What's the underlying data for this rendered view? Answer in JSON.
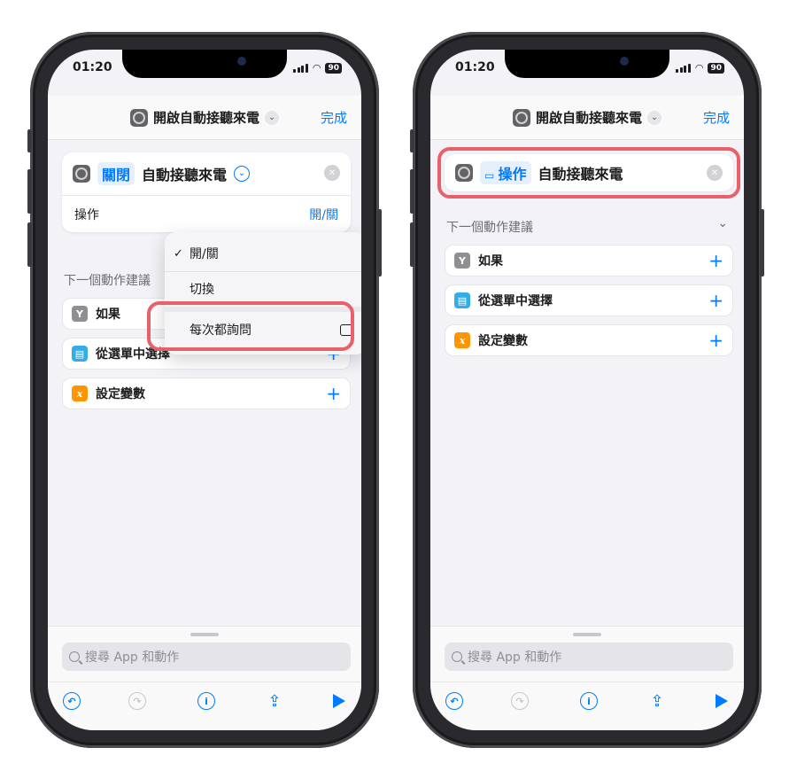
{
  "status": {
    "time": "01:20",
    "battery": "90"
  },
  "header": {
    "title": "開啟自動接聽來電",
    "done_label": "完成"
  },
  "left": {
    "action": {
      "token": "關閉",
      "text": "自動接聽來電",
      "param_label": "操作",
      "param_value": "開/關"
    },
    "section_title": "下一個動作建議",
    "suggestions": [
      {
        "label": "如果",
        "icon": "fork-icon",
        "color": "#8e8e93"
      },
      {
        "label": "從選單中選擇",
        "icon": "menu-icon",
        "color": "#32ade6"
      },
      {
        "label": "設定變數",
        "icon": "variable-icon",
        "color": "#ff9500"
      }
    ],
    "menu": {
      "items": [
        "開/關",
        "切換",
        "每次都詢問"
      ],
      "checked_index": 0
    }
  },
  "right": {
    "action": {
      "token": "操作",
      "text": "自動接聽來電"
    },
    "section_title": "下一個動作建議",
    "suggestions": [
      {
        "label": "如果",
        "icon": "fork-icon",
        "color": "#8e8e93"
      },
      {
        "label": "從選單中選擇",
        "icon": "menu-icon",
        "color": "#32ade6"
      },
      {
        "label": "設定變數",
        "icon": "variable-icon",
        "color": "#ff9500"
      }
    ]
  },
  "search": {
    "placeholder": "搜尋 App 和動作"
  },
  "colors": {
    "accent": "#007aff",
    "highlight": "#e8606a"
  }
}
